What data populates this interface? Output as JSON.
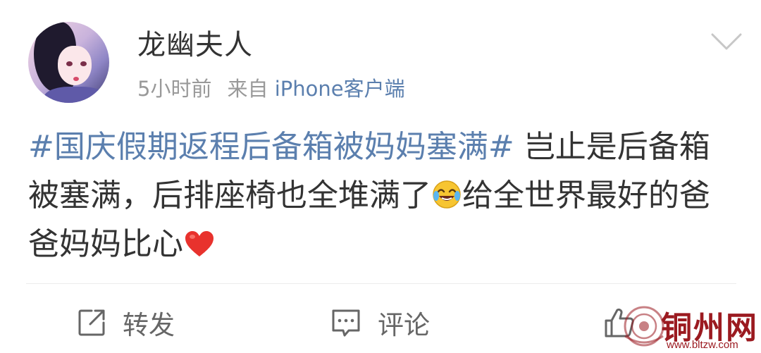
{
  "post": {
    "username": "龙幽夫人",
    "time": "5小时前",
    "source_prefix": "来自",
    "source": "iPhone客户端",
    "hashtag": "#国庆假期返程后备箱被妈妈塞满#",
    "text_part1": " 岂止是后备箱被塞满，后排座椅也全堆满了",
    "text_part2": "给全世界最好的爸爸妈妈比心"
  },
  "actions": {
    "repost": "转发",
    "comment": "评论"
  },
  "watermark": {
    "name": "铜州网",
    "url": "www.bltzw.com"
  },
  "colors": {
    "link": "#5b7fae",
    "text": "#333333",
    "meta": "#999999",
    "watermark": "#9b1a20"
  },
  "icons": {
    "menu": "chevron-down-icon",
    "repost": "share-icon",
    "comment": "comment-icon",
    "like": "thumbs-up-icon",
    "laugh_cry": "laughing-crying-emoji",
    "heart": "heart-emoji"
  }
}
